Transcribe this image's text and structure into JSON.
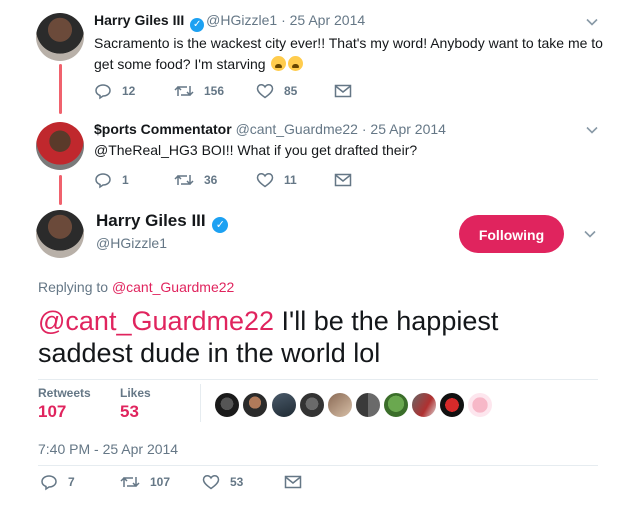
{
  "tweet1": {
    "name": "Harry Giles III",
    "handle": "@HGizzle1",
    "date": "· 25 Apr 2014",
    "text": "Sacramento is the wackest city ever!! That's my word! Anybody want to take me to get some food? I'm starving",
    "replies": "12",
    "retweets": "156",
    "likes": "85"
  },
  "tweet2": {
    "name": "$ports Commentator",
    "handle": "@cant_Guardme22",
    "date": "· 25 Apr 2014",
    "text": "@TheReal_HG3 BOI!! What if you get drafted their?",
    "replies": "1",
    "retweets": "36",
    "likes": "11"
  },
  "main": {
    "name": "Harry Giles III",
    "handle": "@HGizzle1",
    "follow_label": "Following",
    "replying_prefix": "Replying to ",
    "replying_handle": "@cant_Guardme22",
    "mention": "@cant_Guardme22",
    "text": " I'll be the happiest saddest dude in the world lol",
    "retweets_label": "Retweets",
    "retweets_value": "107",
    "likes_label": "Likes",
    "likes_value": "53",
    "timestamp": "7:40 PM - 25 Apr 2014",
    "replies": "7",
    "retweets": "107",
    "likes": "53"
  },
  "colors": {
    "accent": "#e0245e",
    "thread_line": "#f0626d",
    "verified": "#1da1f2",
    "muted": "#657786"
  },
  "icons": [
    "verified-icon",
    "chevron-down-icon",
    "reply-icon",
    "retweet-icon",
    "like-icon",
    "message-icon",
    "weary-face-emoji"
  ]
}
